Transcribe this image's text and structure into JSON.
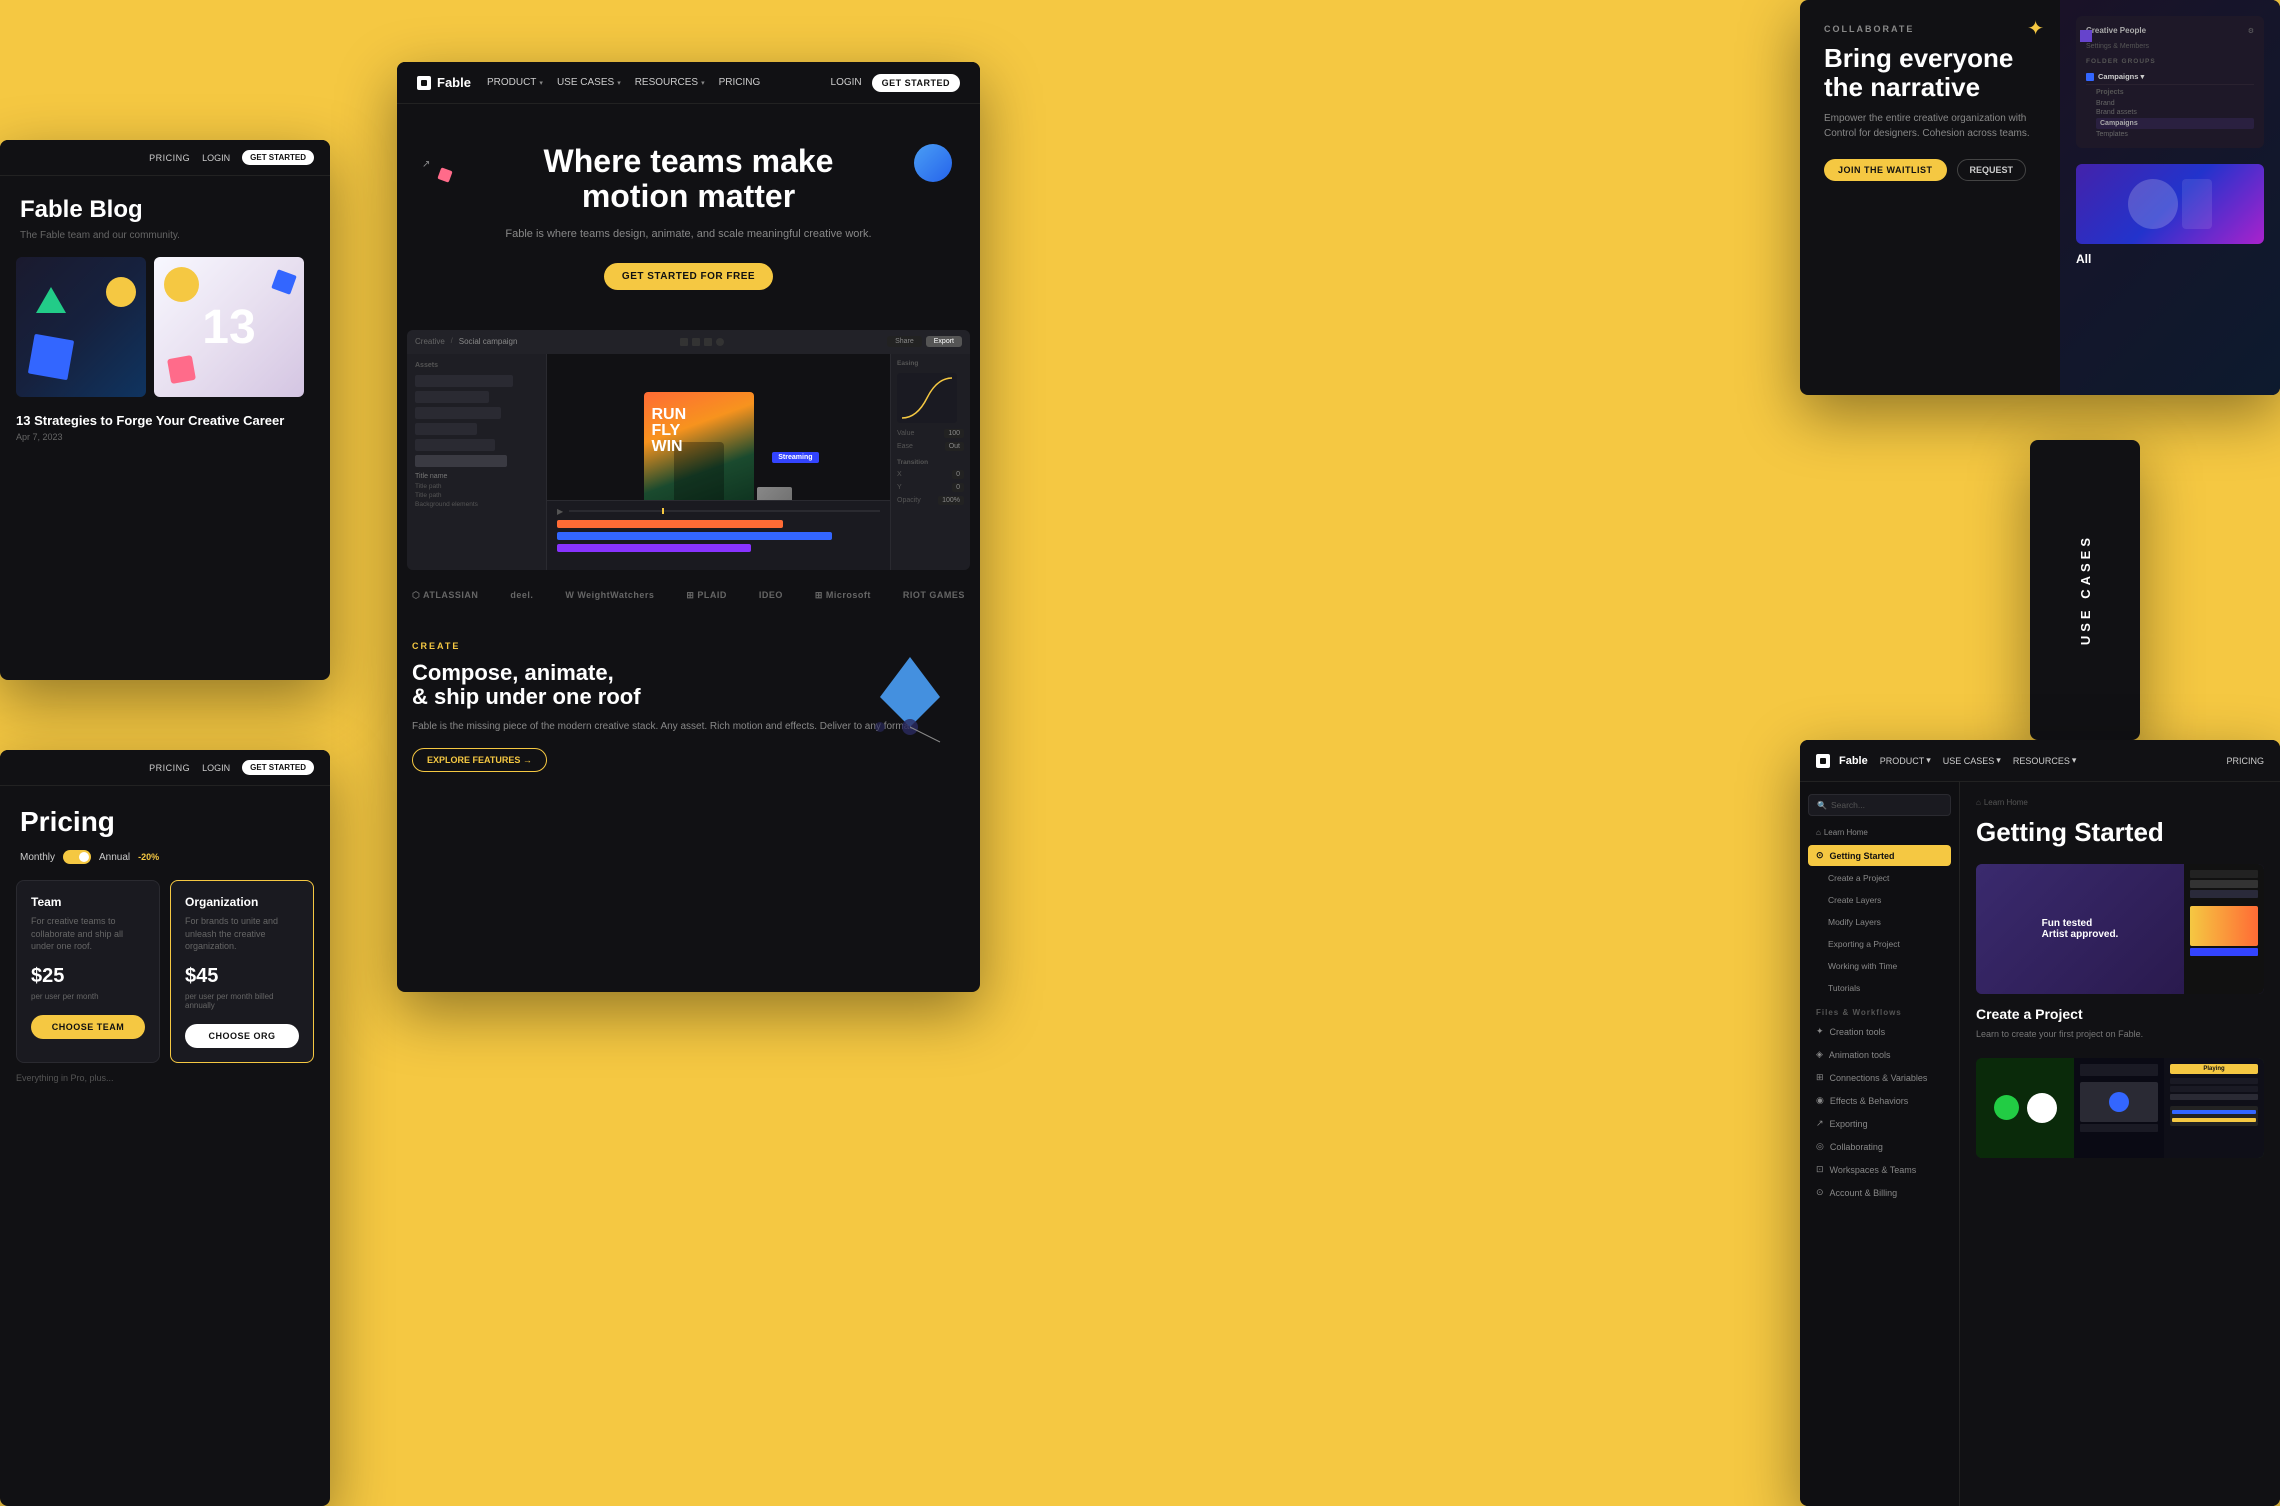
{
  "background_color": "#F5C842",
  "main_panel": {
    "nav": {
      "logo": "Fable",
      "items": [
        "PRODUCT",
        "USE CASES",
        "RESOURCES",
        "PRICING"
      ],
      "login": "LOGIN",
      "cta": "GET STARTED"
    },
    "hero": {
      "title_line1": "Where teams make",
      "title_line2": "motion matter",
      "subtitle": "Fable is where teams design, animate, and scale meaningful creative work.",
      "cta": "GET STARTED FOR FREE"
    },
    "logos": [
      "ATLASSIAN",
      "deel.",
      "W WeightWatchers",
      "PLAID",
      "IDEO",
      "Microsoft",
      "RIOT GAMES"
    ],
    "create": {
      "tag": "CREATE",
      "title_line1": "Compose, animate,",
      "title_line2": "& ship under one roof",
      "desc": "Fable is the missing piece of the modern creative stack. Any asset. Rich motion and effects. Deliver to any format.",
      "cta": "EXPLORE FEATURES →"
    }
  },
  "blog_panel": {
    "nav": {
      "pricing": "PRICING",
      "login": "LOGIN",
      "cta": "GET STARTED"
    },
    "title": "Fable Blog",
    "subtitle": "The Fable team and our community.",
    "card": {
      "number": "13",
      "title": "13 Strategies to Forge Your Creative Career",
      "date": "Apr 7, 2023"
    }
  },
  "pricing_panel": {
    "nav": {
      "pricing": "PRICING",
      "login": "LOGIN",
      "cta": "GET STARTED"
    },
    "title": "Pricing",
    "toggle": {
      "monthly": "Monthly",
      "annual": "Annual",
      "badge": "-20%"
    },
    "cards": [
      {
        "title": "Team",
        "desc": "For creative teams to collaborate and ship all under one roof.",
        "price": "$25",
        "period": "per user per month",
        "cta": "CHOOSE TEAM",
        "style": "yellow"
      },
      {
        "title": "Organization",
        "desc": "For brands to unite and unleash the creative organization.",
        "price": "$45",
        "period": "per user per month billed annually",
        "cta": "CHOOSE ORG",
        "style": "white"
      }
    ],
    "footer": "Everything in Pro, plus..."
  },
  "collab_panel": {
    "tag": "COLLABORATE",
    "title_line1": "Bring everyone",
    "title_line2": "the narrative",
    "desc": "Empower the entire creative organization with Control for designers. Cohesion across teams.",
    "buttons": {
      "primary": "JOIN THE WAITLIST",
      "secondary": "REQUEST"
    },
    "sidebar": {
      "title": "Creative People",
      "items": [
        "Settings & Members"
      ],
      "folder_groups": "FOLDER GROUPS",
      "folders": [
        "Brand",
        "Brand assets",
        "Campaigns",
        "Templates"
      ]
    }
  },
  "usecases_panel": {
    "text": "USE CASES"
  },
  "docs_panel": {
    "nav": {
      "logo": "Fable",
      "items": [
        "PRODUCT",
        "USE CASES",
        "RESOURCES",
        "PRICING"
      ]
    },
    "sidebar": {
      "search_placeholder": "Search...",
      "breadcrumb": "Learn Home",
      "active_item": "Getting Started",
      "items": [
        "Getting Started",
        "Create a Project",
        "Create Layers",
        "Modify Layers",
        "Exporting a Project",
        "Working with Time",
        "Tutorials"
      ],
      "groups": [
        {
          "title": "Files & Workflows",
          "items": [
            "Creation tools",
            "Animation tools",
            "Connections & Variables",
            "Effects & Behaviors",
            "Exporting",
            "Collaborating",
            "Workspaces & Teams",
            "Account & Billing"
          ]
        }
      ]
    },
    "main": {
      "breadcrumb": "Learn Home",
      "title": "Getting Started",
      "section1": {
        "title": "Create a Project",
        "desc": "Learn to create your first project on Fable."
      }
    }
  },
  "icons": {
    "chevron": "▾",
    "search": "🔍",
    "arrow_pointer": "✦",
    "star": "✦"
  }
}
